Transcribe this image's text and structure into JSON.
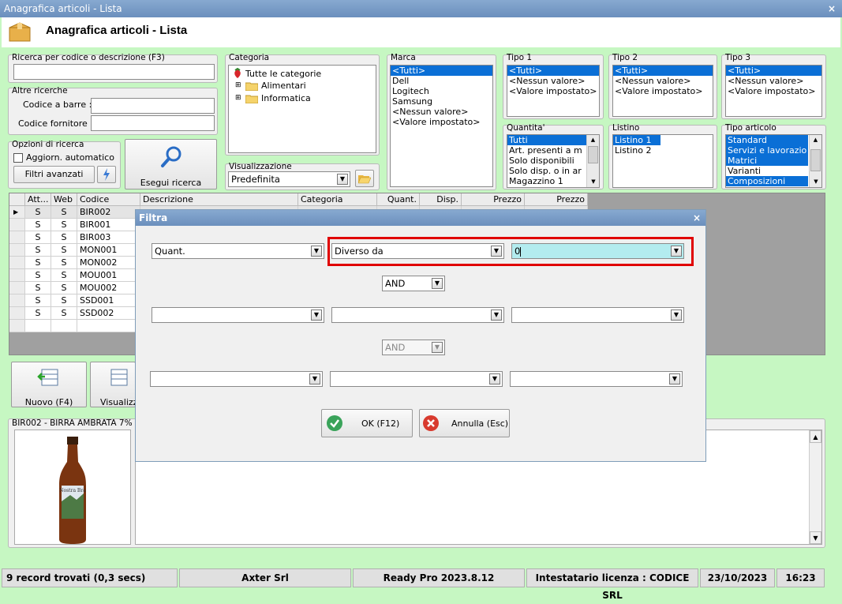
{
  "window": {
    "title": "Anagrafica articoli  - Lista",
    "close": "×"
  },
  "header": {
    "title": "Anagrafica articoli  - Lista"
  },
  "search": {
    "label": "Ricerca per codice o descrizione (F3)",
    "value": "",
    "other_label": "Altre ricerche",
    "barcode_label": "Codice a barre :",
    "supplier_label": "Codice fornitore :",
    "options_label": "Opzioni di ricerca",
    "auto_update_label": "Aggiorn. automatico",
    "advanced_filters": "Filtri avanzati",
    "run_search": "Esegui ricerca"
  },
  "category": {
    "label": "Categoria",
    "root": "Tutte le categorie",
    "children": [
      "Alimentari",
      "Informatica"
    ]
  },
  "view": {
    "label": "Visualizzazione",
    "value": "Predefinita"
  },
  "brand": {
    "label": "Marca",
    "items": [
      "<Tutti>",
      "Dell",
      "Logitech",
      "Samsung",
      "<Nessun valore>",
      "<Valore impostato>"
    ]
  },
  "type1": {
    "label": "Tipo 1",
    "items": [
      "<Tutti>",
      "<Nessun valore>",
      "<Valore impostato>"
    ]
  },
  "type2": {
    "label": "Tipo 2",
    "items": [
      "<Tutti>",
      "<Nessun valore>",
      "<Valore impostato>"
    ]
  },
  "type3": {
    "label": "Tipo 3",
    "items": [
      "<Tutti>",
      "<Nessun valore>",
      "<Valore impostato>"
    ]
  },
  "quantity": {
    "label": "Quantita'",
    "items": [
      "Tutti",
      "Art. presenti a m",
      "Solo disponibili",
      "Solo disp. o in ar",
      "Magazzino 1"
    ]
  },
  "pricelist": {
    "label": "Listino",
    "items": [
      "Listino 1",
      "Listino 2"
    ]
  },
  "article_type": {
    "label": "Tipo articolo",
    "items": [
      "Standard",
      "Servizi e lavorazio",
      "Matrici",
      "Varianti",
      "Composizioni"
    ]
  },
  "table": {
    "headers": [
      "Att...",
      "Web",
      "Codice",
      "Descrizione",
      "Categoria",
      "Quant.",
      "Disp.",
      "Prezzo",
      "Prezzo"
    ],
    "rows": [
      [
        "S",
        "S",
        "BIR002"
      ],
      [
        "S",
        "S",
        "BIR001"
      ],
      [
        "S",
        "S",
        "BIR003"
      ],
      [
        "S",
        "S",
        "MON001"
      ],
      [
        "S",
        "S",
        "MON002"
      ],
      [
        "S",
        "S",
        "MOU001"
      ],
      [
        "S",
        "S",
        "MOU002"
      ],
      [
        "S",
        "S",
        "SSD001"
      ],
      [
        "S",
        "S",
        "SSD002"
      ]
    ]
  },
  "actions": {
    "new": "Nuovo (F4)",
    "view": "Visualizza"
  },
  "preview": {
    "label": "BIR002 - BIRRA AMBRATA 7% V",
    "bottle_label": "Nostra Bra"
  },
  "dialog": {
    "title": "Filtra",
    "close": "×",
    "row1": {
      "field": "Quant.",
      "operator": "Diverso da",
      "value": "0"
    },
    "logic1": "AND",
    "logic2": "AND",
    "ok": "OK (F12)",
    "cancel": "Annulla (Esc)"
  },
  "status": {
    "records": "9 record trovati (0,3 secs)",
    "company": "Axter Srl",
    "version": "Ready Pro 2023.8.12",
    "license": "Intestatario licenza : CODICE SRL",
    "date": "23/10/2023",
    "time": "16:23"
  },
  "colors": {
    "accent": "#0a6fd6",
    "background": "#c6f7c2",
    "highlight": "#e00000",
    "value_field": "#b3ecef"
  }
}
